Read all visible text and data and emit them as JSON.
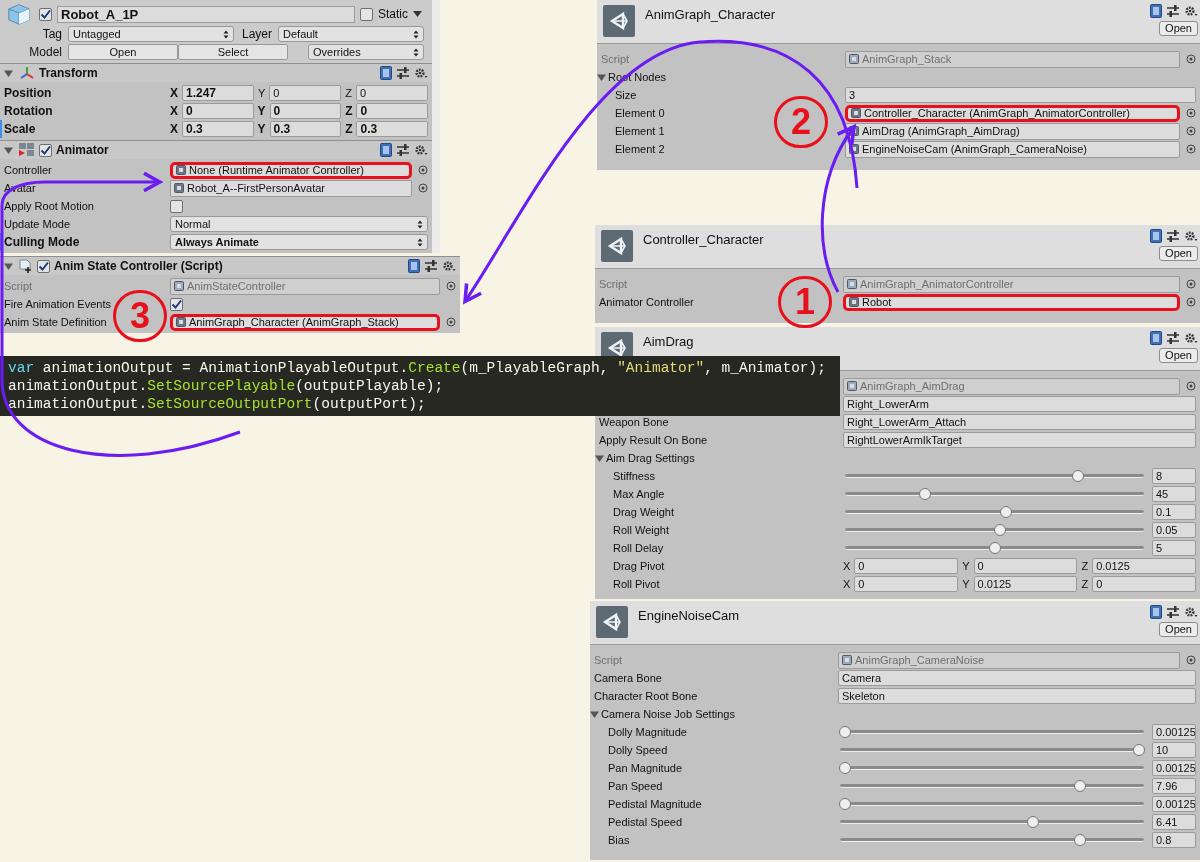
{
  "game_object": {
    "enabled": true,
    "name": "Robot_A_1P",
    "static": false,
    "static_label": "Static",
    "tag_label": "Tag",
    "tag": "Untagged",
    "layer_label": "Layer",
    "layer": "Default",
    "model_label": "Model",
    "model_buttons": [
      "Open",
      "Select"
    ],
    "overrides": "Overrides"
  },
  "transform": {
    "title": "Transform",
    "rows": [
      {
        "kind": "vector",
        "label": "Position",
        "bold": true,
        "override_bar": false,
        "fields": [
          {
            "axis": "X",
            "value": "1.247",
            "bold": true
          },
          {
            "axis": "Y",
            "value": "0",
            "bold": false
          },
          {
            "axis": "Z",
            "value": "0",
            "bold": false
          }
        ]
      },
      {
        "kind": "vector",
        "label": "Rotation",
        "bold": true,
        "override_bar": false,
        "fields": [
          {
            "axis": "X",
            "value": "0",
            "bold": true
          },
          {
            "axis": "Y",
            "value": "0",
            "bold": true
          },
          {
            "axis": "Z",
            "value": "0",
            "bold": true
          }
        ]
      },
      {
        "kind": "vector",
        "label": "Scale",
        "bold": true,
        "override_bar": true,
        "fields": [
          {
            "axis": "X",
            "value": "0.3",
            "bold": true
          },
          {
            "axis": "Y",
            "value": "0.3",
            "bold": true
          },
          {
            "axis": "Z",
            "value": "0.3",
            "bold": true
          }
        ]
      }
    ]
  },
  "animator": {
    "enabled": true,
    "title": "Animator",
    "rows": [
      {
        "kind": "object",
        "label": "Controller",
        "value": "None (Runtime Animator Controller)",
        "highlighted": true
      },
      {
        "kind": "object",
        "label": "Avatar",
        "value": "Robot_A--FirstPersonAvatar",
        "highlighted": false
      },
      {
        "kind": "checkbox",
        "label": "Apply Root Motion",
        "checked": false
      },
      {
        "kind": "dropdown",
        "label": "Update Mode",
        "value": "Normal",
        "bold": false,
        "override_bar": false
      },
      {
        "kind": "dropdown",
        "label": "Culling Mode",
        "value": "Always Animate",
        "bold": true,
        "override_bar": true
      }
    ]
  },
  "anim_state_controller": {
    "enabled": true,
    "title": "Anim State Controller (Script)",
    "rows": [
      {
        "kind": "script",
        "label": "Script",
        "value": "AnimStateController"
      },
      {
        "kind": "checkbox",
        "label": "Fire Animation Events",
        "checked": true
      },
      {
        "kind": "object",
        "label": "Anim State Definition",
        "value": "AnimGraph_Character (AnimGraph_Stack)",
        "highlighted": true
      }
    ]
  },
  "code": {
    "lines": [
      [
        {
          "kind": "keyword",
          "text": "var"
        },
        {
          "kind": "plain",
          "text": " animationOutput = AnimationPlayableOutput."
        },
        {
          "kind": "method",
          "text": "Create"
        },
        {
          "kind": "plain",
          "text": "(m_PlayableGraph, "
        },
        {
          "kind": "string",
          "text": "\"Animator\""
        },
        {
          "kind": "plain",
          "text": ", m_Animator);"
        }
      ],
      [
        {
          "kind": "plain",
          "text": "animationOutput."
        },
        {
          "kind": "method",
          "text": "SetSourcePlayable"
        },
        {
          "kind": "plain",
          "text": "(outputPlayable);"
        }
      ],
      [
        {
          "kind": "plain",
          "text": "animationOutput."
        },
        {
          "kind": "method",
          "text": "SetSourceOutputPort"
        },
        {
          "kind": "plain",
          "text": "(outputPort);"
        }
      ]
    ]
  },
  "assets": [
    {
      "title": "AnimGraph_Character",
      "open_button": "Open",
      "rows": [
        {
          "kind": "script",
          "label": "Script",
          "value": "AnimGraph_Stack"
        },
        {
          "kind": "foldout",
          "label": "Root Nodes",
          "expanded": true,
          "children": [
            {
              "kind": "text",
              "label": "Size",
              "value": "3"
            },
            {
              "kind": "object",
              "label": "Element 0",
              "value": "Controller_Character (AnimGraph_AnimatorController)",
              "highlighted": true
            },
            {
              "kind": "object",
              "label": "Element 1",
              "value": "AimDrag (AnimGraph_AimDrag)",
              "highlighted": false
            },
            {
              "kind": "object",
              "label": "Element 2",
              "value": "EngineNoiseCam (AnimGraph_CameraNoise)",
              "highlighted": false
            }
          ]
        }
      ]
    },
    {
      "title": "Controller_Character",
      "open_button": "Open",
      "rows": [
        {
          "kind": "script",
          "label": "Script",
          "value": "AnimGraph_AnimatorController"
        },
        {
          "kind": "object",
          "label": "Animator Controller",
          "value": "Robot",
          "highlighted": true
        }
      ]
    },
    {
      "title": "AimDrag",
      "open_button": "Open",
      "rows": [
        {
          "kind": "script",
          "value": "AnimGraph_AimDrag"
        },
        {
          "kind": "text",
          "value": "Right_LowerArm"
        },
        {
          "kind": "text",
          "label": "Weapon Bone",
          "value": "Right_LowerArm_Attach"
        },
        {
          "kind": "text",
          "label": "Apply Result On Bone",
          "value": "RightLowerArmIkTarget"
        },
        {
          "kind": "foldout",
          "label": "Aim Drag Settings",
          "expanded": true,
          "children": [
            {
              "kind": "slider",
              "label": "Stiffness",
              "level": 0.79,
              "value": "8"
            },
            {
              "kind": "slider",
              "label": "Max Angle",
              "level": 0.26,
              "value": "45"
            },
            {
              "kind": "slider",
              "label": "Drag Weight",
              "level": 0.54,
              "value": "0.1"
            },
            {
              "kind": "slider",
              "label": "Roll Weight",
              "level": 0.52,
              "value": "0.05"
            },
            {
              "kind": "slider",
              "label": "Roll Delay",
              "level": 0.5,
              "value": "5"
            },
            {
              "kind": "vector",
              "label": "Drag Pivot",
              "fields": [
                {
                  "axis": "X",
                  "value": "0"
                },
                {
                  "axis": "Y",
                  "value": "0"
                },
                {
                  "axis": "Z",
                  "value": "0.0125"
                }
              ]
            },
            {
              "kind": "vector",
              "label": "Roll Pivot",
              "fields": [
                {
                  "axis": "X",
                  "value": "0"
                },
                {
                  "axis": "Y",
                  "value": "0.0125"
                },
                {
                  "axis": "Z",
                  "value": "0"
                }
              ]
            }
          ]
        }
      ]
    },
    {
      "title": "EngineNoiseCam",
      "open_button": "Open",
      "rows": [
        {
          "kind": "script",
          "label": "Script",
          "value": "AnimGraph_CameraNoise"
        },
        {
          "kind": "text",
          "label": "Camera Bone",
          "value": "Camera"
        },
        {
          "kind": "text",
          "label": "Character Root Bone",
          "value": "Skeleton"
        },
        {
          "kind": "foldout",
          "label": "Camera Noise Job Settings",
          "expanded": true,
          "children": [
            {
              "kind": "slider",
              "label": "Dolly Magnitude",
              "level": 0,
              "value": "0.00125"
            },
            {
              "kind": "slider",
              "label": "Dolly Speed",
              "level": 1,
              "value": "10"
            },
            {
              "kind": "slider",
              "label": "Pan Magnitude",
              "level": 0,
              "value": "0.00125"
            },
            {
              "kind": "slider",
              "label": "Pan Speed",
              "level": 0.8,
              "value": "7.96"
            },
            {
              "kind": "slider",
              "label": "Pedistal Magnitude",
              "level": 0,
              "value": "0.00125"
            },
            {
              "kind": "slider",
              "label": "Pedistal Speed",
              "level": 0.64,
              "value": "6.41"
            },
            {
              "kind": "slider",
              "label": "Bias",
              "level": 0.8,
              "value": "0.8"
            }
          ]
        }
      ]
    }
  ],
  "annotations": [
    {
      "label": "3"
    },
    {
      "label": "2"
    },
    {
      "label": "1"
    }
  ]
}
